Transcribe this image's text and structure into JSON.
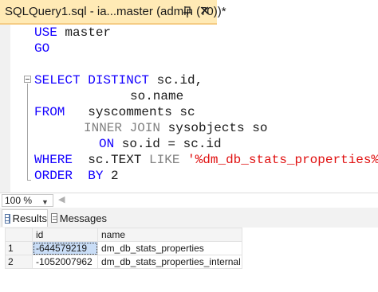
{
  "tab": {
    "title": "SQLQuery1.sql - ia...master (admin (70))*",
    "close_glyph": "✕"
  },
  "editor": {
    "line1": {
      "kw": "USE",
      "rest": " master"
    },
    "line2": {
      "kw": "GO"
    },
    "line4": {
      "kw": "SELECT DISTINCT",
      "rest": " sc.id,"
    },
    "line5": {
      "text": "so.name"
    },
    "line6": {
      "kw": "FROM",
      "rest": "   syscomments sc"
    },
    "line7": {
      "join": "INNER JOIN",
      "rest": " sysobjects so"
    },
    "line8": {
      "kw": "ON",
      "rest": " so.id = sc.id"
    },
    "line9": {
      "kw": "WHERE",
      "col": "  sc.TEXT",
      "op": " LIKE",
      "str": " '%dm_db_stats_properties%'"
    },
    "line10": {
      "kw": "ORDER",
      "kw2": "  BY",
      "rest": " 2"
    }
  },
  "status": {
    "zoom": "100 %"
  },
  "results_tabs": {
    "results_label": "Results",
    "messages_label": "Messages"
  },
  "grid": {
    "columns": [
      "id",
      "name"
    ],
    "rows": [
      {
        "num": "1",
        "id": "-644579219",
        "name": "dm_db_stats_properties"
      },
      {
        "num": "2",
        "id": "-1052007962",
        "name": "dm_db_stats_properties_internal"
      }
    ]
  },
  "colors": {
    "tab_background": "#ffeab5",
    "keyword": "#1400ff",
    "string": "#e01010",
    "operator": "#808080"
  }
}
